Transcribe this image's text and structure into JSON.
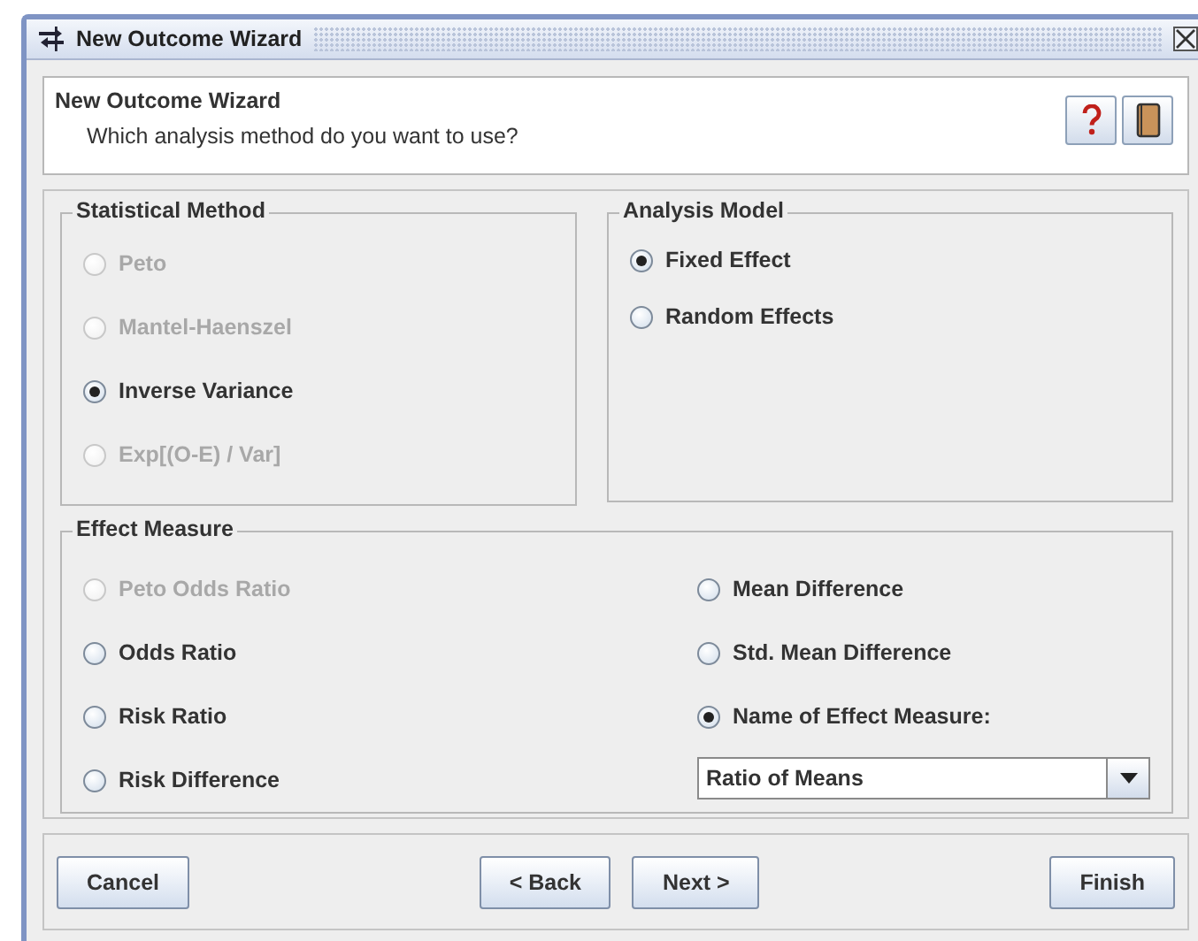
{
  "window": {
    "title": "New Outcome Wizard"
  },
  "header": {
    "title": "New Outcome Wizard",
    "subtitle": "Which analysis method do you want to use?"
  },
  "statistical_method": {
    "label": "Statistical Method",
    "options": [
      {
        "label": "Peto",
        "selected": false,
        "disabled": true
      },
      {
        "label": "Mantel-Haenszel",
        "selected": false,
        "disabled": true
      },
      {
        "label": "Inverse Variance",
        "selected": true,
        "disabled": false
      },
      {
        "label": "Exp[(O-E) / Var]",
        "selected": false,
        "disabled": true
      }
    ]
  },
  "analysis_model": {
    "label": "Analysis Model",
    "options": [
      {
        "label": "Fixed Effect",
        "selected": true,
        "disabled": false
      },
      {
        "label": "Random Effects",
        "selected": false,
        "disabled": false
      }
    ]
  },
  "effect_measure": {
    "label": "Effect Measure",
    "options": [
      {
        "label": "Peto Odds Ratio",
        "selected": false,
        "disabled": true
      },
      {
        "label": "Mean Difference",
        "selected": false,
        "disabled": false
      },
      {
        "label": "Odds Ratio",
        "selected": false,
        "disabled": false
      },
      {
        "label": "Std. Mean Difference",
        "selected": false,
        "disabled": false
      },
      {
        "label": "Risk Ratio",
        "selected": false,
        "disabled": false
      },
      {
        "label": "Name of Effect Measure:",
        "selected": true,
        "disabled": false
      },
      {
        "label": "Risk Difference",
        "selected": false,
        "disabled": false
      }
    ],
    "custom_name": {
      "value": "Ratio of Means"
    }
  },
  "buttons": [
    {
      "label": "Cancel"
    },
    {
      "label": "< Back"
    },
    {
      "label": "Next >"
    },
    {
      "label": "Finish"
    }
  ]
}
